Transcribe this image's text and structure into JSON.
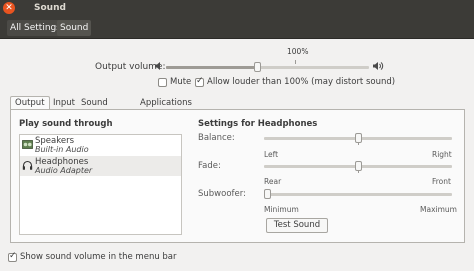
{
  "window": {
    "title": "Sound",
    "close_glyph": "✕"
  },
  "toolbar": {
    "all_settings": "All Settings",
    "current": "Sound"
  },
  "output_volume": {
    "label": "Output volume:",
    "hundred_percent_label": "100%",
    "level": 0.45,
    "mute_label": "Mute",
    "mute_checked": false,
    "allow_louder_label": "Allow louder than 100% (may distort sound)",
    "allow_louder_checked": true
  },
  "tabs": [
    {
      "label": "Output",
      "active": true
    },
    {
      "label": "Input",
      "active": false
    },
    {
      "label": "Sound Effects",
      "active": false
    },
    {
      "label": "Applications",
      "active": false
    }
  ],
  "play_sound_through": {
    "title": "Play sound through",
    "devices": [
      {
        "name": "Speakers",
        "subtitle": "Built-in Audio",
        "icon": "speaker-device-icon",
        "selected": false
      },
      {
        "name": "Headphones",
        "subtitle": "Audio Adapter",
        "icon": "headphones-icon",
        "selected": true
      }
    ]
  },
  "settings": {
    "title": "Settings for Headphones",
    "balance": {
      "label": "Balance:",
      "left": "Left",
      "right": "Right",
      "value": 0.5
    },
    "fade": {
      "label": "Fade:",
      "left": "Rear",
      "right": "Front",
      "value": 0.5
    },
    "subwoofer": {
      "label": "Subwoofer:",
      "left": "Minimum",
      "right": "Maximum",
      "value": 0.0
    },
    "test_button": "Test Sound"
  },
  "footer": {
    "show_volume_label": "Show sound volume in the menu bar",
    "show_volume_checked": true
  },
  "colors": {
    "titlebar": "#3c3b37",
    "accent_close": "#e95420",
    "window_bg": "#f2f1f0"
  }
}
